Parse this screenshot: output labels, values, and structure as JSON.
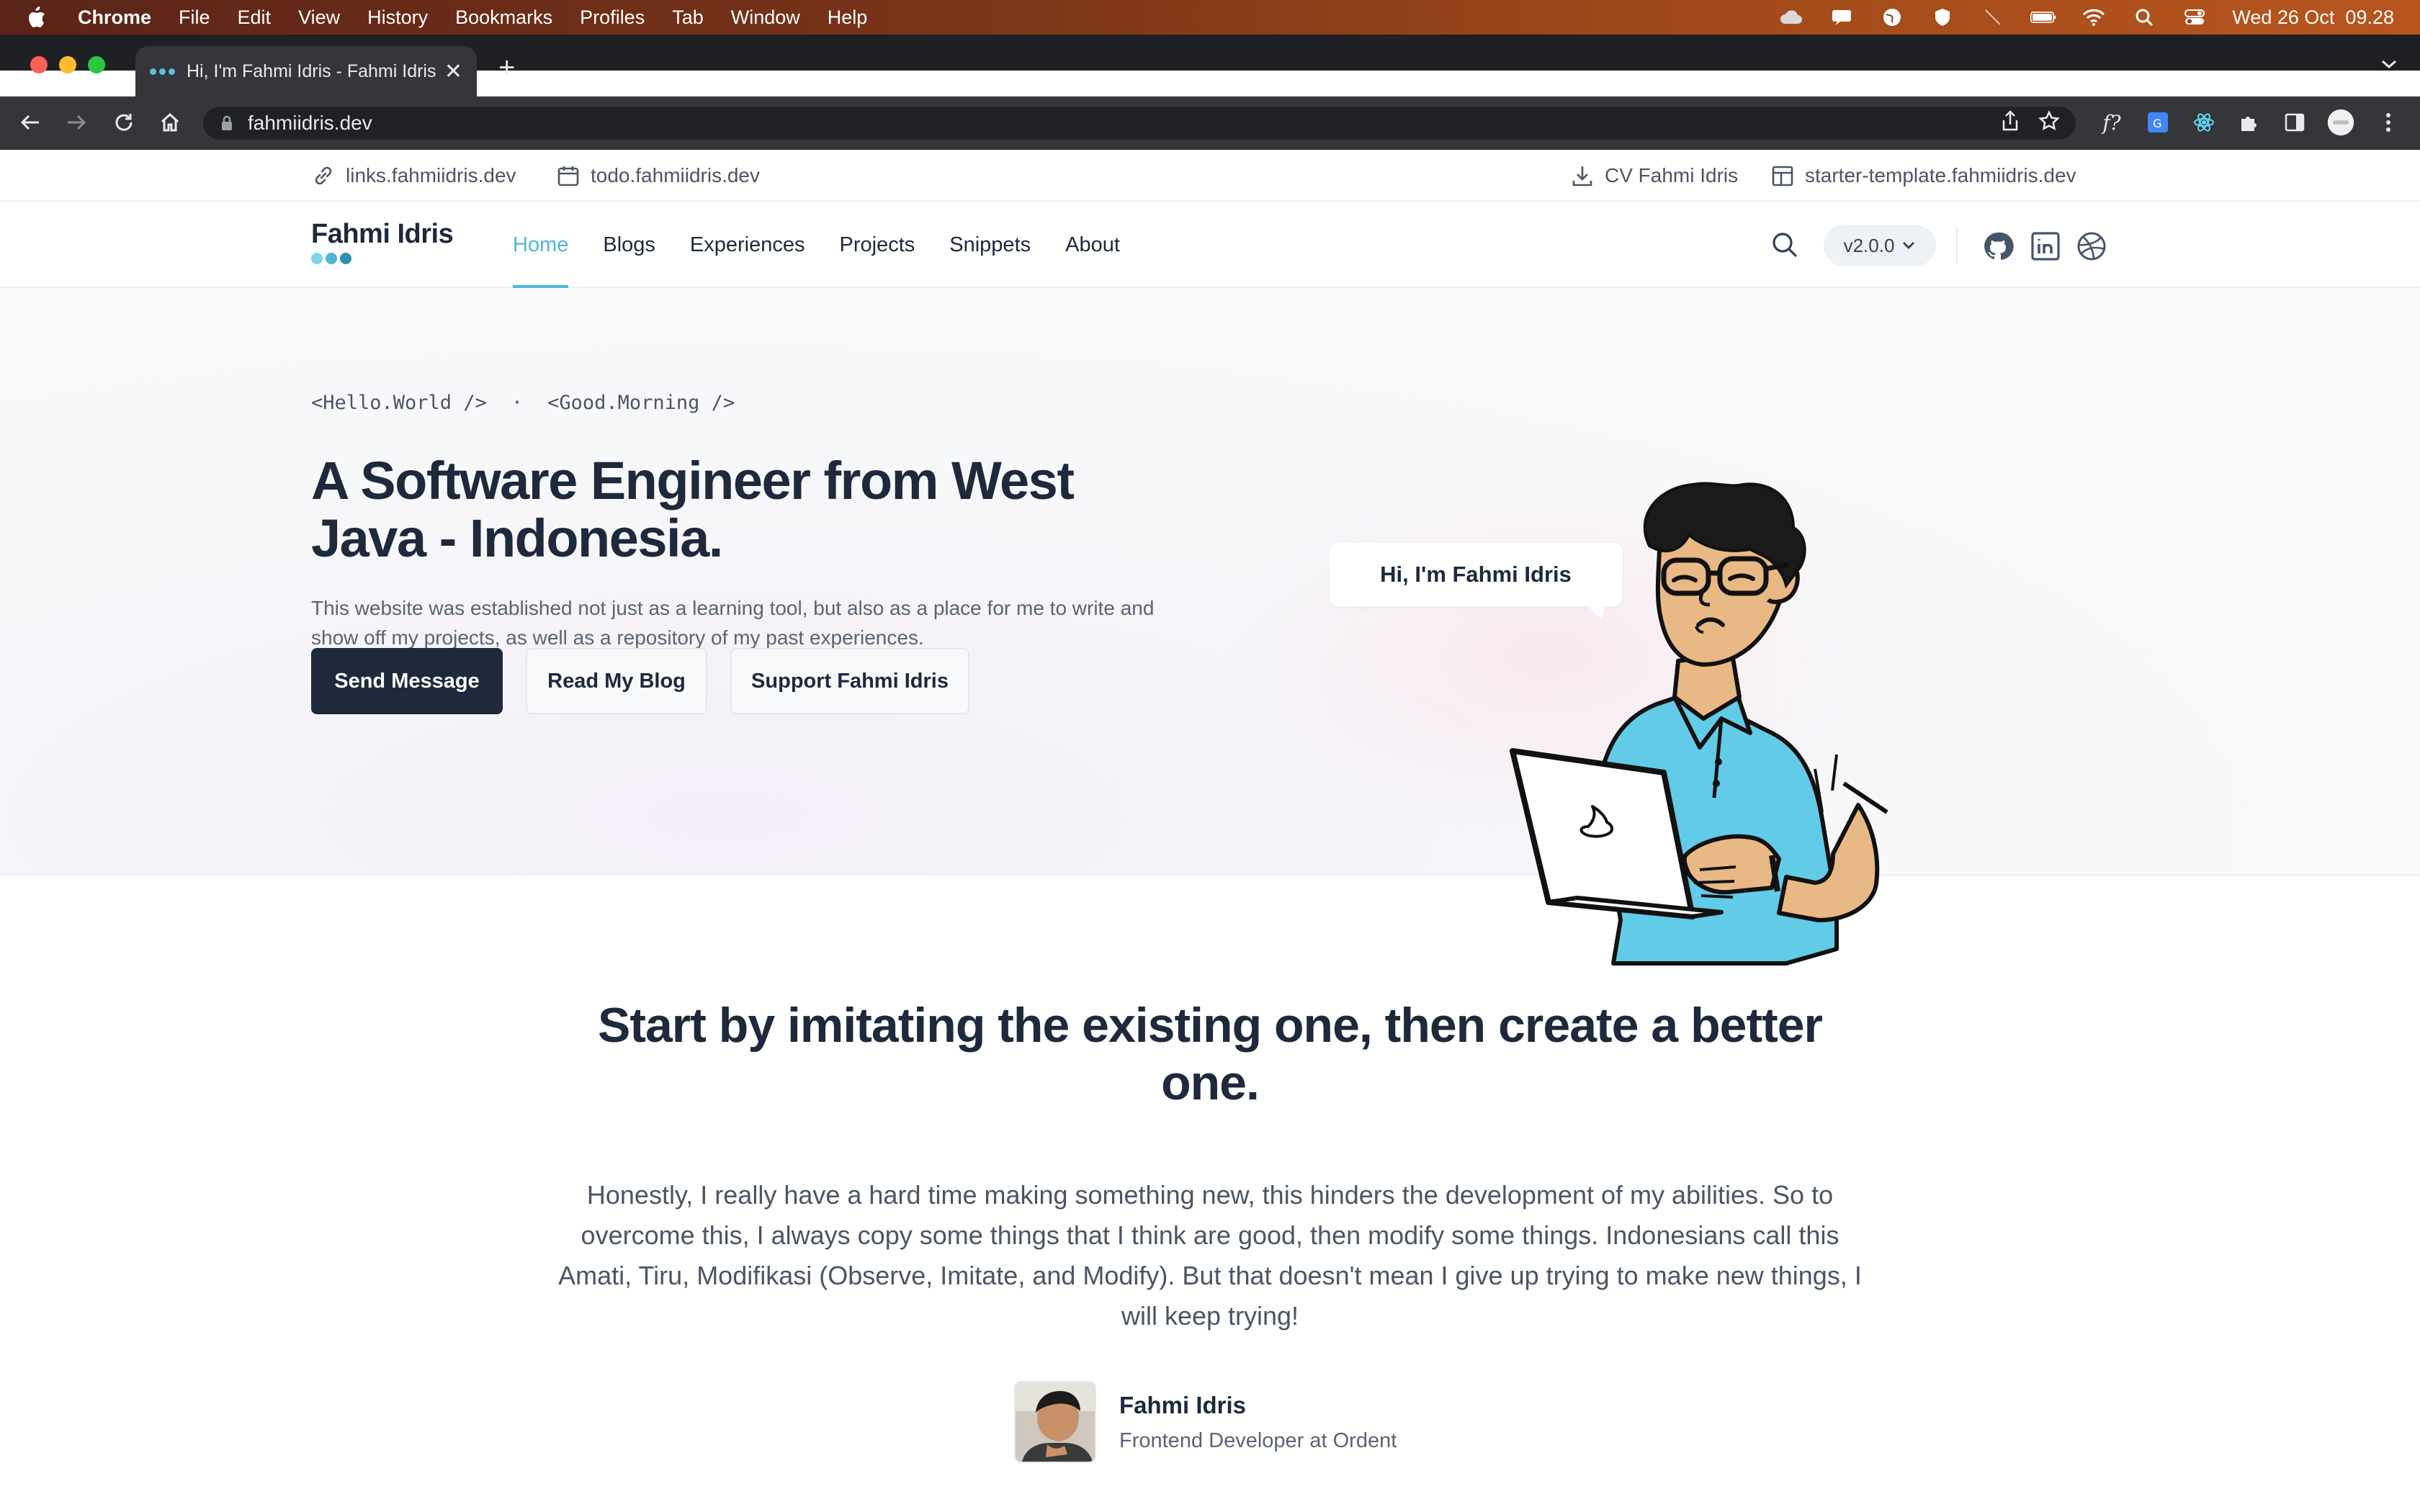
{
  "menubar": {
    "app": "Chrome",
    "items": [
      "File",
      "Edit",
      "View",
      "History",
      "Bookmarks",
      "Profiles",
      "Tab",
      "Window",
      "Help"
    ],
    "clock": "Wed 26 Oct  09.28"
  },
  "browser": {
    "tab_title": "Hi, I'm Fahmi Idris - Fahmi Idris",
    "url": "fahmiidris.dev"
  },
  "site": {
    "top_links": {
      "links": "links.fahmiidris.dev",
      "todo": "todo.fahmiidris.dev",
      "cv": "CV Fahmi Idris",
      "starter": "starter-template.fahmiidris.dev"
    },
    "logo": "Fahmi Idris",
    "nav": [
      "Home",
      "Blogs",
      "Experiences",
      "Projects",
      "Snippets",
      "About"
    ],
    "active_nav": "Home",
    "version": "v2.0.0"
  },
  "hero": {
    "greet1": "<Hello.World />",
    "separator": "·",
    "greet2": "<Good.Morning />",
    "title": "A Software Engineer from West Java - Indonesia.",
    "description": "This website was established not just as a learning tool, but also as a place for me to write and show off my projects, as well as a repository of my past experiences.",
    "buttons": {
      "send": "Send Message",
      "blog": "Read My Blog",
      "support": "Support Fahmi Idris"
    },
    "bubble": "Hi, I'm Fahmi Idris"
  },
  "quote": {
    "title": "Start by imitating the existing one, then create a better one.",
    "body": "Honestly, I really have a hard time making something new, this hinders the development of my abilities. So to overcome this, I always copy some things that I think are good, then modify some things. Indonesians call this Amati, Tiru, Modifikasi (Observe, Imitate, and Modify). But that doesn't mean I give up trying to make new things, I will keep trying!",
    "author_name": "Fahmi Idris",
    "author_role": "Frontend Developer at Ordent"
  },
  "colors": {
    "accent": "#4fb7d6",
    "dark": "#1e293b",
    "shirt": "#62cbe8",
    "skin": "#e8b984"
  },
  "icons": {
    "social": [
      "github-icon",
      "linkedin-icon",
      "dribbble-icon"
    ]
  }
}
